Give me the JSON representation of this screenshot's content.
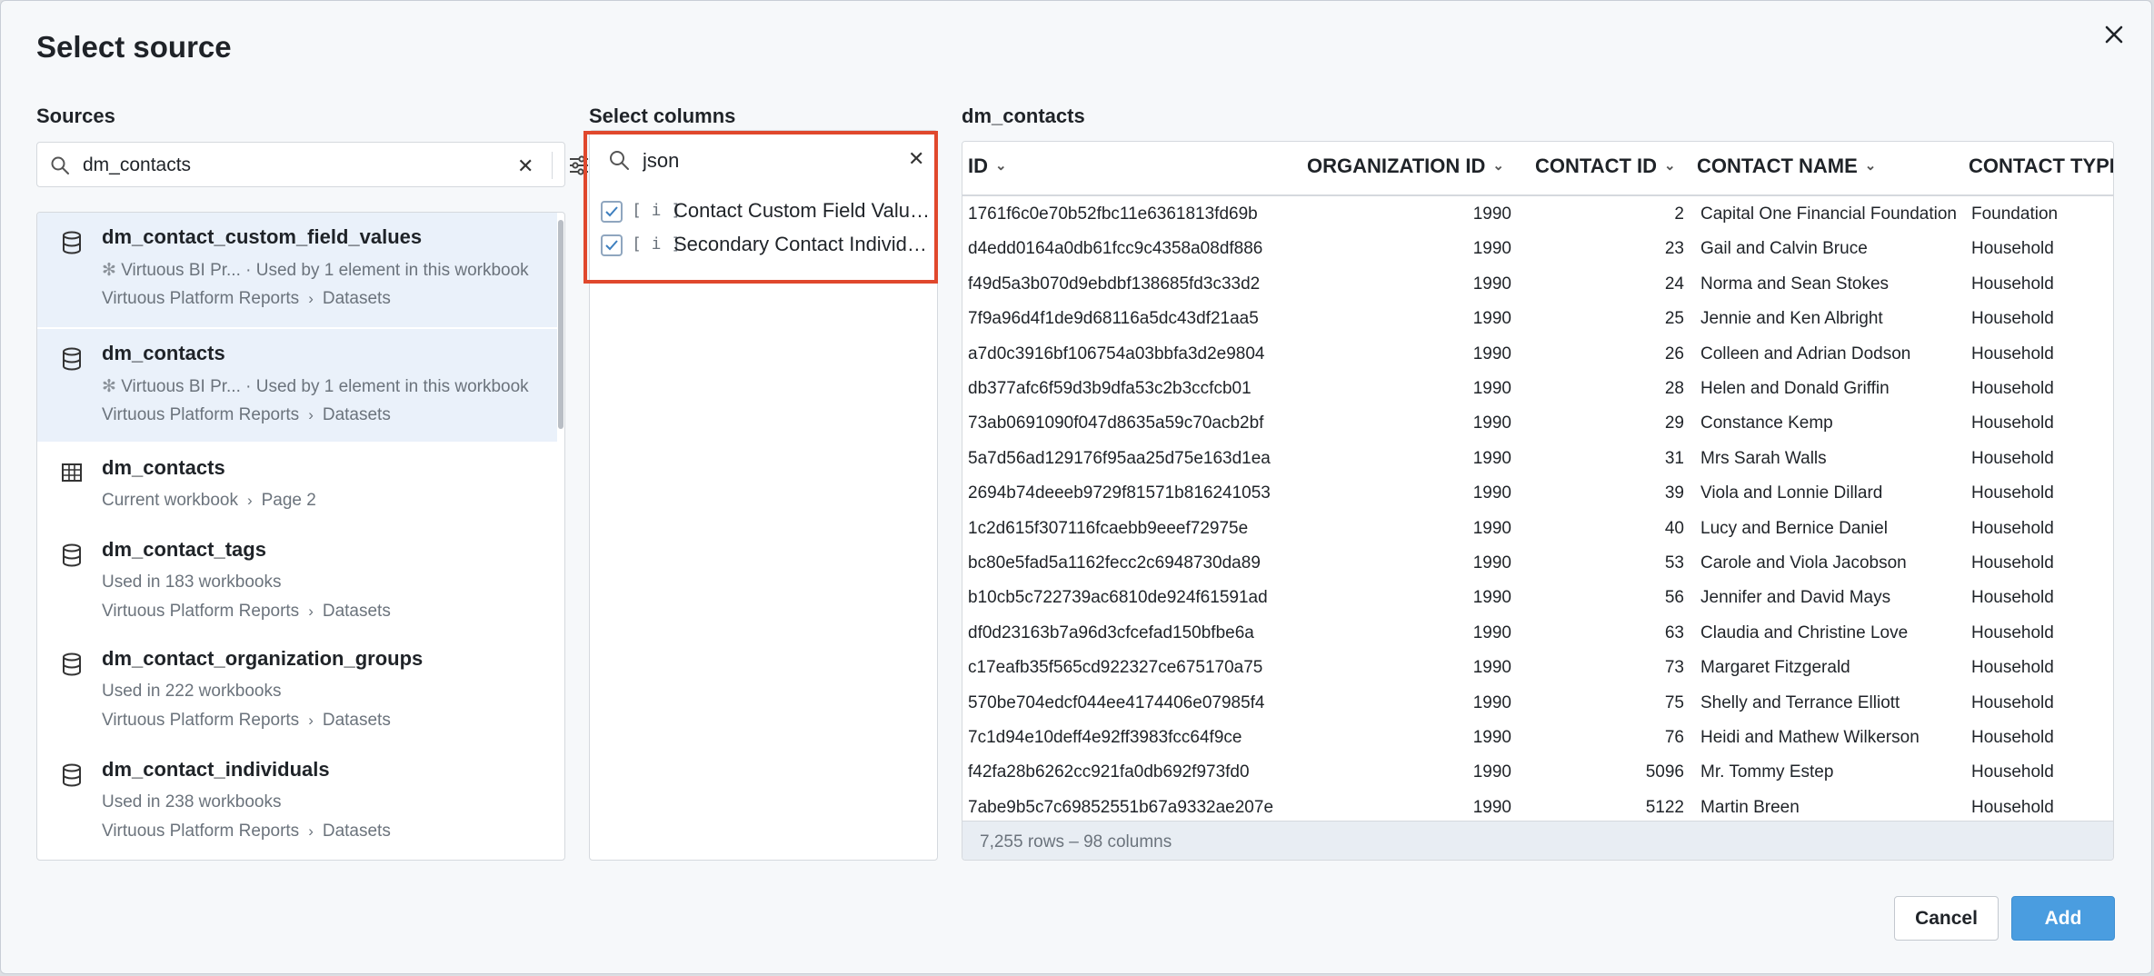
{
  "dialog": {
    "title": "Select source",
    "close_icon": "close-icon"
  },
  "sources": {
    "label": "Sources",
    "search_value": "dm_contacts",
    "items": [
      {
        "name": "dm_contact_custom_field_values",
        "icon": "database-icon",
        "badge_icon": "snowflake-icon",
        "connection": "Virtuous BI Pr...",
        "usage": "· Used by 1 element in this workbook",
        "path_root": "Virtuous Platform Reports",
        "path_leaf": "Datasets",
        "selected": true
      },
      {
        "name": "dm_contacts",
        "icon": "database-icon",
        "badge_icon": "snowflake-icon",
        "connection": "Virtuous BI Pr...",
        "usage": "· Used by 1 element in this workbook",
        "path_root": "Virtuous Platform Reports",
        "path_leaf": "Datasets",
        "selected": true
      },
      {
        "name": "dm_contacts",
        "icon": "table-icon",
        "path_root": "Current workbook",
        "path_leaf": "Page 2"
      },
      {
        "name": "dm_contact_tags",
        "icon": "database-icon",
        "usage": "Used in 183 workbooks",
        "path_root": "Virtuous Platform Reports",
        "path_leaf": "Datasets"
      },
      {
        "name": "dm_contact_organization_groups",
        "icon": "database-icon",
        "usage": "Used in 222 workbooks",
        "path_root": "Virtuous Platform Reports",
        "path_leaf": "Datasets"
      },
      {
        "name": "dm_contact_individuals",
        "icon": "database-icon",
        "usage": "Used in 238 workbooks",
        "path_root": "Virtuous Platform Reports",
        "path_leaf": "Datasets"
      }
    ]
  },
  "columns": {
    "label": "Select columns",
    "search_value": "json",
    "type_glyph": "[ i ]",
    "items": [
      {
        "name": "Contact Custom Field Values Json",
        "checked": true
      },
      {
        "name": "Secondary Contact Individuals Json",
        "checked": true
      }
    ]
  },
  "preview": {
    "label": "dm_contacts",
    "headers": [
      "ID",
      "ORGANIZATION ID",
      "CONTACT ID",
      "CONTACT NAME",
      "CONTACT TYPE"
    ],
    "rows": [
      [
        "1761f6c0e70b52fbc11e6361813fd69b",
        "1990",
        "2",
        "Capital One Financial Foundation",
        "Foundation"
      ],
      [
        "d4edd0164a0db61fcc9c4358a08df886",
        "1990",
        "23",
        "Gail and Calvin Bruce",
        "Household"
      ],
      [
        "f49d5a3b070d9ebdbf138685fd3c33d2",
        "1990",
        "24",
        "Norma and Sean Stokes",
        "Household"
      ],
      [
        "7f9a96d4f1de9d68116a5dc43df21aa5",
        "1990",
        "25",
        "Jennie and Ken Albright",
        "Household"
      ],
      [
        "a7d0c3916bf106754a03bbfa3d2e9804",
        "1990",
        "26",
        "Colleen and Adrian Dodson",
        "Household"
      ],
      [
        "db377afc6f59d3b9dfa53c2b3ccfcb01",
        "1990",
        "28",
        "Helen and Donald Griffin",
        "Household"
      ],
      [
        "73ab0691090f047d8635a59c70acb2bf",
        "1990",
        "29",
        "Constance Kemp",
        "Household"
      ],
      [
        "5a7d56ad129176f95aa25d75e163d1ea",
        "1990",
        "31",
        "Mrs Sarah Walls",
        "Household"
      ],
      [
        "2694b74deeeb9729f81571b816241053",
        "1990",
        "39",
        "Viola and Lonnie Dillard",
        "Household"
      ],
      [
        "1c2d615f307116fcaebb9eeef72975e",
        "1990",
        "40",
        "Lucy and Bernice Daniel",
        "Household"
      ],
      [
        "bc80e5fad5a1162fecc2c6948730da89",
        "1990",
        "53",
        "Carole and Viola Jacobson",
        "Household"
      ],
      [
        "b10cb5c722739ac6810de924f61591ad",
        "1990",
        "56",
        "Jennifer and David Mays",
        "Household"
      ],
      [
        "df0d23163b7a96d3cfcefad150bfbe6a",
        "1990",
        "63",
        "Claudia and Christine Love",
        "Household"
      ],
      [
        "c17eafb35f565cd922327ce675170a75",
        "1990",
        "73",
        "Margaret Fitzgerald",
        "Household"
      ],
      [
        "570be704edcf044ee4174406e07985f4",
        "1990",
        "75",
        "Shelly and Terrance Elliott",
        "Household"
      ],
      [
        "7c1d94e10deff4e92ff3983fcc64f9ce",
        "1990",
        "76",
        "Heidi and Mathew Wilkerson",
        "Household"
      ],
      [
        "f42fa28b6262cc921fa0db692f973fd0",
        "1990",
        "5096",
        "Mr. Tommy Estep",
        "Household"
      ],
      [
        "7abe9b5c7c69852551b67a9332ae207e",
        "1990",
        "5122",
        "Martin Breen",
        "Household"
      ]
    ],
    "footer": "7,255 rows – 98 columns"
  },
  "buttons": {
    "cancel": "Cancel",
    "add": "Add"
  },
  "colors": {
    "accent": "#4a9de0",
    "highlight": "#e0482d",
    "selected_row": "#eaf1fa"
  }
}
